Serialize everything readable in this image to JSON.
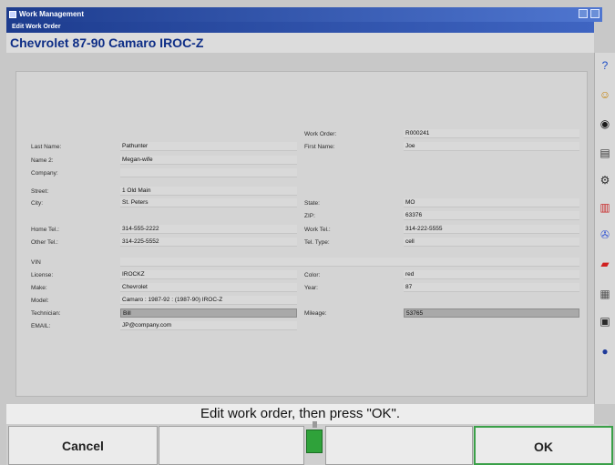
{
  "window": {
    "title": "Work Management",
    "subtitle": "Edit Work Order"
  },
  "vehicle": {
    "name": "Chevrolet 87-90 Camaro IROC-Z"
  },
  "form": {
    "work_order_label": "Work Order:",
    "work_order": "R000241",
    "last_name_label": "Last Name:",
    "last_name": "Pathunter",
    "first_name_label": "First Name:",
    "first_name": "Joe",
    "name2_label": "Name 2:",
    "name2": "Megan-wife",
    "company_label": "Company:",
    "company": "",
    "street_label": "Street:",
    "street": "1 Old Main",
    "city_label": "City:",
    "city": "St. Peters",
    "state_label": "State:",
    "state": "MO",
    "zip_label": "ZIP:",
    "zip": "63376",
    "home_tel_label": "Home Tel.:",
    "home_tel": "314-555-2222",
    "work_tel_label": "Work Tel.:",
    "work_tel": "314-222-5555",
    "other_tel_label": "Other Tel.:",
    "other_tel": "314-225-5552",
    "tel_type_label": "Tel. Type:",
    "tel_type": "cell",
    "vin_label": "VIN",
    "vin": "",
    "license_label": "License:",
    "license": "IROCKZ",
    "color_label": "Color:",
    "color": "red",
    "make_label": "Make:",
    "make": "Chevrolet",
    "year_label": "Year:",
    "year": "87",
    "model_label": "Model:",
    "model": "Camaro : 1987-92 : (1987-90) IROC-Z",
    "technician_label": "Technician:",
    "technician": "Bill",
    "mileage_label": "Mileage:",
    "mileage": "53765",
    "email_label": "EMAIL:",
    "email": "JP@company.com"
  },
  "status_message": "Edit work order, then press \"OK\".",
  "buttons": {
    "cancel": "Cancel",
    "ok": "OK"
  },
  "sidebar": {
    "icons": [
      {
        "name": "help-icon",
        "glyph": "?",
        "color": "#1f4fc6"
      },
      {
        "name": "operator-icon",
        "glyph": "☺",
        "color": "#c47f00"
      },
      {
        "name": "wheel-icon",
        "glyph": "◉",
        "color": "#1c1c1c"
      },
      {
        "name": "printer-icon",
        "glyph": "▤",
        "color": "#3a3a3a"
      },
      {
        "name": "specifications-icon",
        "glyph": "⚙",
        "color": "#2a2a2a"
      },
      {
        "name": "measure-icon",
        "glyph": "▥",
        "color": "#c92a2a"
      },
      {
        "name": "tools-icon",
        "glyph": "✇",
        "color": "#3a5bd4"
      },
      {
        "name": "vehicle-icon",
        "glyph": "▰",
        "color": "#d02020"
      },
      {
        "name": "document-icon",
        "glyph": "▦",
        "color": "#555555"
      },
      {
        "name": "shop-icon",
        "glyph": "▣",
        "color": "#2b2b2b"
      },
      {
        "name": "globe-icon",
        "glyph": "●",
        "color": "#1f3b9a"
      }
    ]
  },
  "colors": {
    "title_bar": "#1d3c8e",
    "accent": "#0d2d86",
    "ok_border": "#3aa048",
    "indicator": "#2fa23a"
  }
}
